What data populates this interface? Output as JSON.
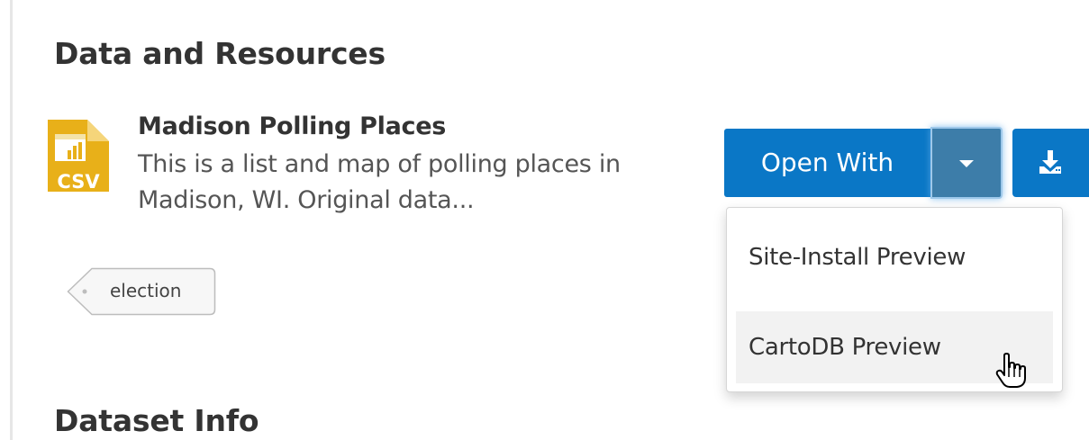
{
  "sections": {
    "data_resources_title": "Data and Resources",
    "dataset_info_title": "Dataset Info"
  },
  "resource": {
    "icon": "csv-file-icon",
    "format_label": "CSV",
    "title": "Madison Polling Places",
    "description": "This is a list and map of polling places in Madison, WI. Original data..."
  },
  "tags": [
    {
      "label": "election"
    }
  ],
  "actions": {
    "open_with_label": "Open With",
    "caret_icon": "caret-down-icon",
    "download_icon": "download-icon"
  },
  "dropdown": {
    "items": [
      {
        "label": "Site-Install Preview"
      },
      {
        "label": "CartoDB Preview",
        "hovered": true
      }
    ]
  },
  "colors": {
    "primary_button": "#0a77c6",
    "caret_button_active": "#3d7da9",
    "csv_icon": "#e8b019",
    "menu_hover": "#f2f2f2"
  }
}
